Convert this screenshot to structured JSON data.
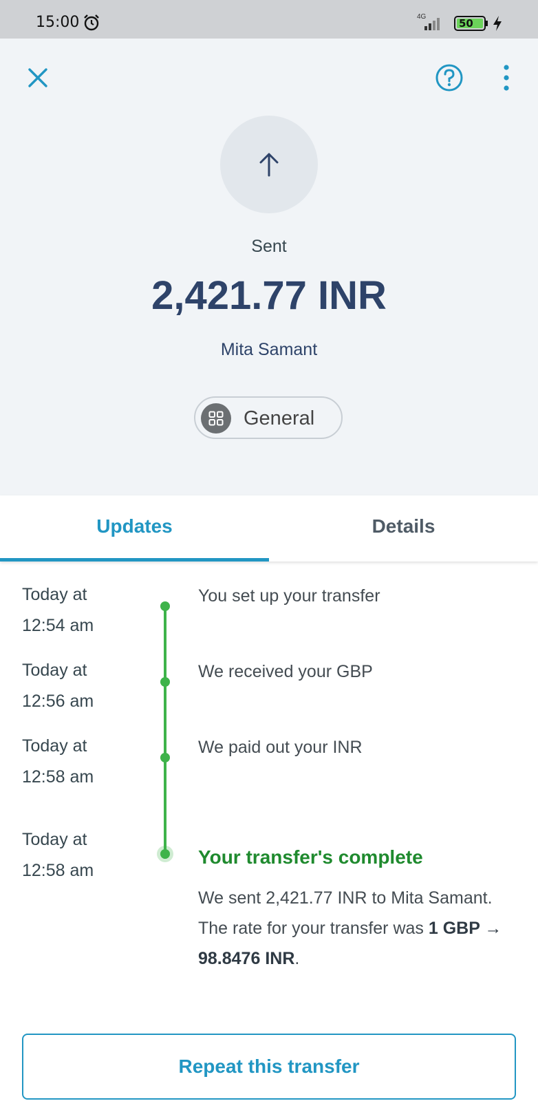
{
  "status_bar": {
    "time": "15:00",
    "network": "4G",
    "battery": "50"
  },
  "header": {
    "status_label": "Sent",
    "amount": "2,421.77 INR",
    "recipient": "Mita Samant",
    "category": "General"
  },
  "tabs": [
    {
      "label": "Updates",
      "active": true
    },
    {
      "label": "Details",
      "active": false
    }
  ],
  "timeline": [
    {
      "time_line1": "Today at",
      "time_line2": "12:54 am",
      "event": "You set up your transfer"
    },
    {
      "time_line1": "Today at",
      "time_line2": "12:56 am",
      "event": "We received your GBP"
    },
    {
      "time_line1": "Today at",
      "time_line2": "12:58 am",
      "event": "We paid out your INR"
    },
    {
      "time_line1": "Today at",
      "time_line2": "12:58 am",
      "event": "Your transfer's complete",
      "desc_prefix": "We sent 2,421.77 INR to Mita Samant. The rate for your transfer was ",
      "desc_rate": "1 GBP → 98.8476 INR",
      "desc_suffix": "."
    }
  ],
  "actions": {
    "repeat_label": "Repeat this transfer"
  },
  "colors": {
    "accent": "#2196c3",
    "success": "#3eb34a",
    "amount": "#2e4369",
    "header_bg": "#f1f4f7"
  }
}
